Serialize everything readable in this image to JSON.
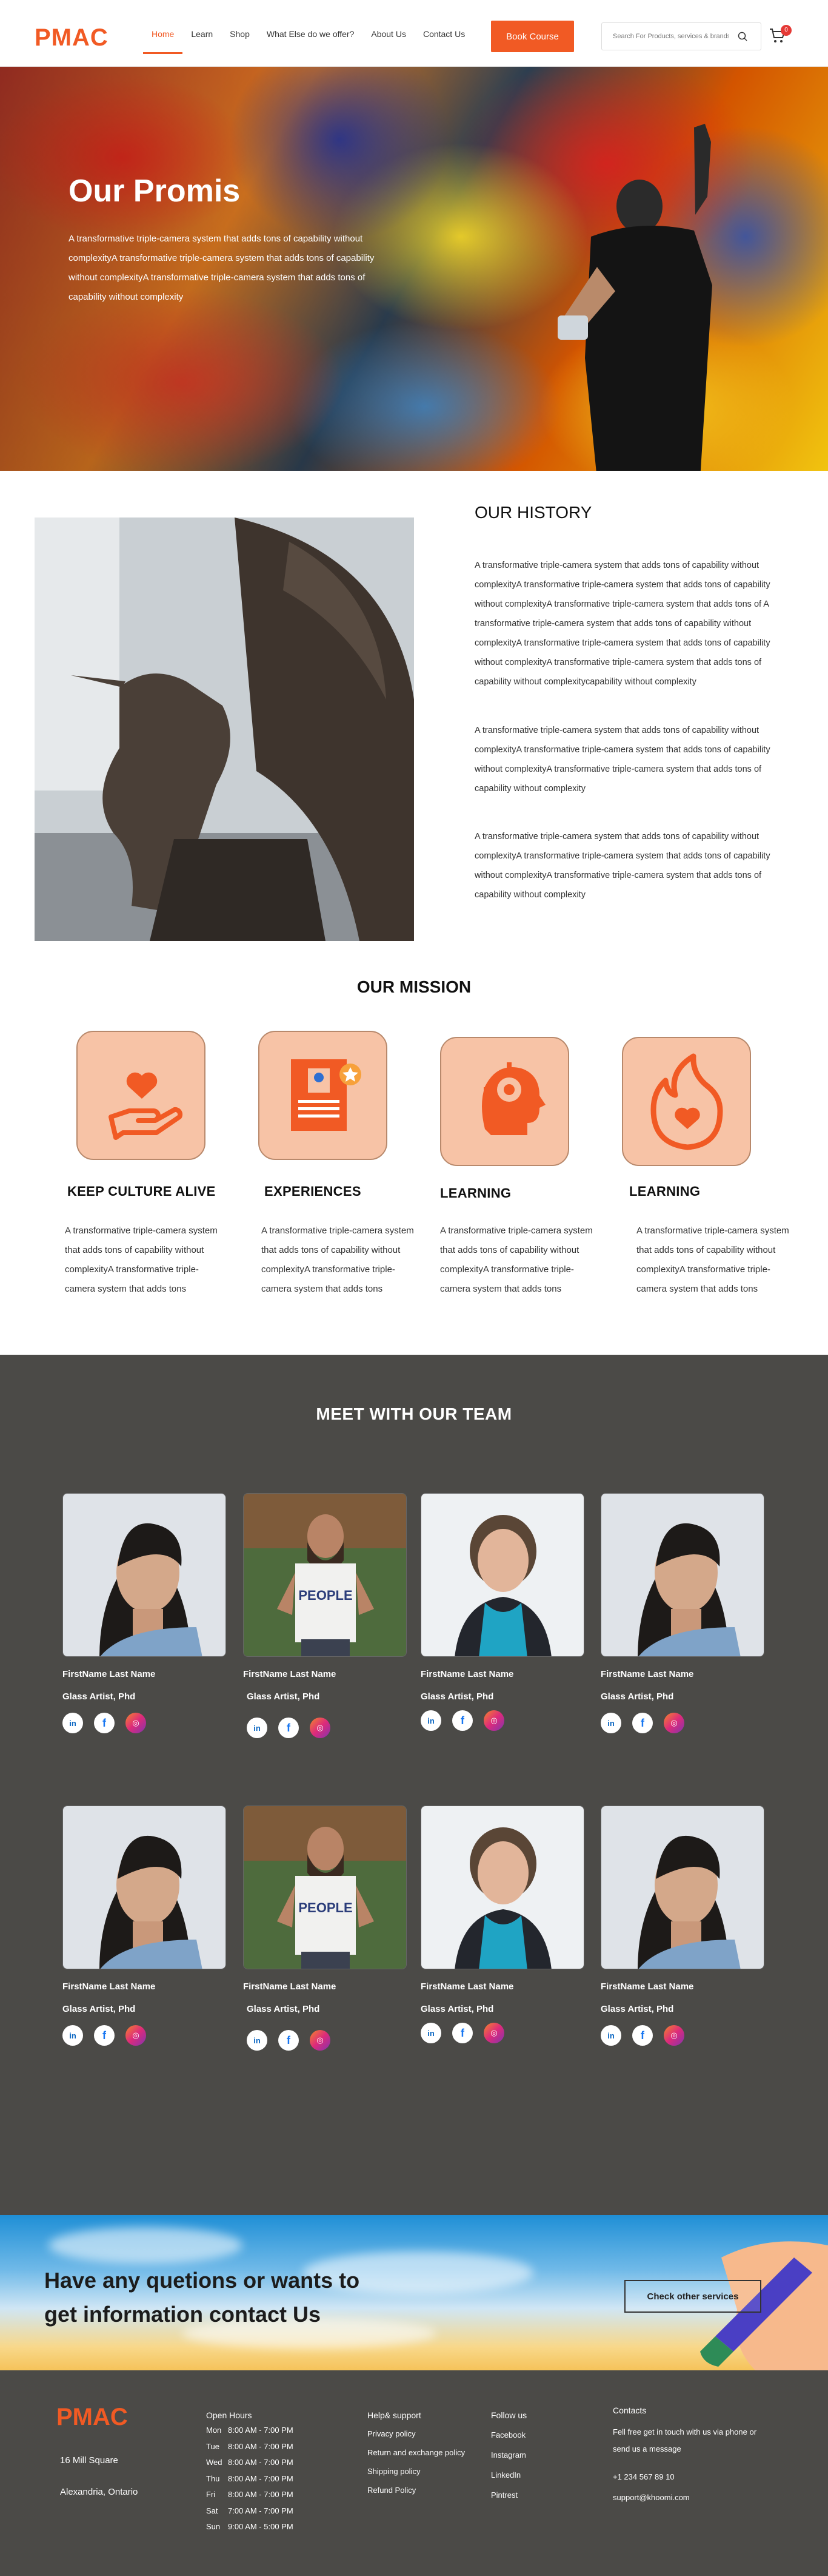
{
  "header": {
    "logo": "PMAC",
    "nav": [
      {
        "label": "Home",
        "active": true
      },
      {
        "label": "Learn"
      },
      {
        "label": "Shop"
      },
      {
        "label": "What Else do we offer?"
      },
      {
        "label": "About Us"
      },
      {
        "label": "Contact Us"
      }
    ],
    "book_button": "Book Course",
    "search_placeholder": "Search For Products, services & brands",
    "cart_count": "0"
  },
  "hero": {
    "title": "Our Promis",
    "text": "A transformative triple-camera system that adds tons of capability without complexityA transformative triple-camera system that adds tons of capability without complexityA transformative triple-camera system that adds tons of capability without complexity"
  },
  "history": {
    "title": "OUR HISTORY",
    "p1": "A transformative triple-camera system that adds tons of capability without complexityA transformative triple-camera system that adds tons of capability without complexityA transformative triple-camera system that adds tons of A transformative triple-camera system that adds tons of capability without complexityA transformative triple-camera system that adds tons of capability without complexityA transformative triple-camera system that adds tons of capability without complexitycapability without complexity",
    "p2": "A transformative triple-camera system that adds tons of capability without complexityA transformative triple-camera system that adds tons of capability without complexityA transformative triple-camera system that adds tons of capability without complexity",
    "p3": "A transformative triple-camera system that adds tons of capability without complexityA transformative triple-camera system that adds tons of capability without complexityA transformative triple-camera system that adds tons of capability without complexity"
  },
  "mission": {
    "title": "OUR MISSION",
    "items": [
      {
        "heading": "KEEP CULTURE ALIVE",
        "icon": "heart-hand-icon",
        "text": "A transformative triple-camera system that adds tons of capability without complexityA transformative triple-camera system that adds tons"
      },
      {
        "heading": "EXPERIENCES",
        "icon": "certificate-icon",
        "text": "A transformative triple-camera system that adds tons of capability without complexityA transformative triple-camera system that adds tons"
      },
      {
        "heading": "LEARNING",
        "icon": "brain-gear-icon",
        "text": "A transformative triple-camera system that adds tons of capability without complexityA transformative triple-camera system that adds tons"
      },
      {
        "heading": "LEARNING",
        "icon": "flame-heart-icon",
        "text": "A transformative triple-camera system that adds tons of capability without complexityA transformative triple-camera system that adds tons"
      }
    ]
  },
  "team": {
    "title": "MEET WITH OUR TEAM",
    "members": [
      {
        "name": "FirstName Last Name",
        "role": "Glass Artist, Phd"
      },
      {
        "name": "FirstName Last Name",
        "role": "Glass Artist, Phd"
      },
      {
        "name": "FirstName Last Name",
        "role": "Glass Artist, Phd"
      },
      {
        "name": "FirstName Last Name",
        "role": "Glass Artist, Phd"
      },
      {
        "name": "FirstName Last Name",
        "role": "Glass Artist, Phd"
      },
      {
        "name": "FirstName Last Name",
        "role": "Glass Artist, Phd"
      },
      {
        "name": "FirstName Last Name",
        "role": "Glass Artist, Phd"
      },
      {
        "name": "FirstName Last Name",
        "role": "Glass Artist, Phd"
      }
    ],
    "social": {
      "linkedin": "in",
      "facebook": "f",
      "instagram": "◎"
    }
  },
  "cta": {
    "line1": "Have any quetions  or  wants to",
    "line2": "get information contact  Us",
    "button": "Check other services"
  },
  "footer": {
    "logo": "PMAC",
    "address1": "16 Mill Square",
    "address2": "Alexandria, Ontario",
    "hours_title": "Open Hours",
    "hours": [
      {
        "day": "Mon",
        "time": "8:00 AM - 7:00 PM"
      },
      {
        "day": "Tue",
        "time": "8:00 AM - 7:00 PM"
      },
      {
        "day": "Wed",
        "time": "8:00 AM - 7:00 PM"
      },
      {
        "day": "Thu",
        "time": "8:00 AM - 7:00 PM"
      },
      {
        "day": "Fri",
        "time": "8:00 AM - 7:00 PM"
      },
      {
        "day": "Sat",
        "time": "7:00 AM - 7:00 PM"
      },
      {
        "day": "Sun",
        "time": "9:00 AM - 5:00 PM"
      }
    ],
    "help_title": "Help& support",
    "help": [
      "Privacy policy",
      "Return and exchange policy",
      "Shipping policy",
      "Refund Policy"
    ],
    "follow_title": "Follow us",
    "follow": [
      "Facebook",
      "Instagram",
      "LinkedIn",
      "Pintrest"
    ],
    "contacts_title": "Contacts",
    "contacts_text": "Fell free get in touch with us via phone or send us a message",
    "phone": "+1 234 567 89 10",
    "email": "support@khoomi.com"
  },
  "colors": {
    "accent": "#f15a24",
    "team_bg": "#4b4a47",
    "icon_tile": "#f7c3a6",
    "icon_fill": "#f15a24"
  }
}
